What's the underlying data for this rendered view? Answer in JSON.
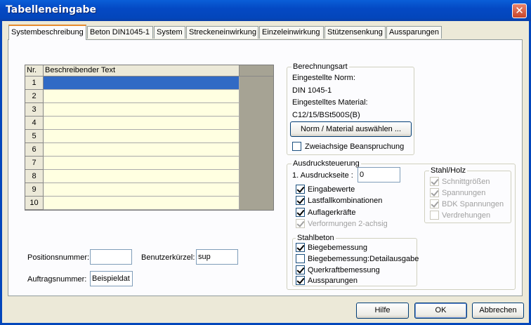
{
  "window": {
    "title": "Tabelleneingabe",
    "close_glyph": "✕"
  },
  "tabs": [
    {
      "label": "Systembeschreibung",
      "active": true
    },
    {
      "label": "Beton DIN1045-1"
    },
    {
      "label": "System"
    },
    {
      "label": "Streckeneinwirkung"
    },
    {
      "label": "Einzeleinwirkung"
    },
    {
      "label": "Stützensenkung"
    },
    {
      "label": "Aussparungen"
    }
  ],
  "table": {
    "col_nr": "Nr.",
    "col_text": "Beschreibender Text",
    "rows": [
      "1",
      "2",
      "3",
      "4",
      "5",
      "6",
      "7",
      "8",
      "9",
      "10"
    ],
    "selected_row": 1
  },
  "berechnungsart": {
    "title": "Berechnungsart",
    "norm_label": "Eingestellte Norm:",
    "norm_value": "DIN 1045-1",
    "material_label": "Eingestelltes Material:",
    "material_value": "C12/15/BSt500S(B)",
    "select_button": "Norm / Material auswählen ...",
    "zweiachsig": {
      "label": "Zweiachsige Beanspruchung",
      "checked": false
    }
  },
  "ausdruck": {
    "title": "Ausdrucksteuerung",
    "seite_label": "1. Ausdruckseite :",
    "seite_value": "0",
    "items": [
      {
        "label": "Eingabewerte",
        "checked": true
      },
      {
        "label": "Lastfallkombinationen",
        "checked": true
      },
      {
        "label": "Auflagerkräfte",
        "checked": true
      },
      {
        "label": "Verformungen 2-achsig",
        "checked": true,
        "disabled": true
      }
    ],
    "stahlholz": {
      "title": "Stahl/Holz",
      "items": [
        {
          "label": "Schnittgrößen",
          "checked": true
        },
        {
          "label": "Spannungen",
          "checked": true
        },
        {
          "label": "BDK Spannungen",
          "checked": true
        },
        {
          "label": "Verdrehungen",
          "checked": false
        }
      ]
    },
    "stahlbeton": {
      "title": "Stahlbeton",
      "items": [
        {
          "label": "Biegebemessung",
          "checked": true
        },
        {
          "label": "Biegebemessung:Detailausgabe",
          "checked": false
        },
        {
          "label": "Querkraftbemessung",
          "checked": true
        },
        {
          "label": "Aussparungen",
          "checked": true
        }
      ]
    }
  },
  "fields": {
    "position_label": "Positionsnummer:",
    "position_value": "",
    "benutzer_label": "Benutzerkürzel:",
    "benutzer_value": "sup",
    "auftrag_label": "Auftragsnummer:",
    "auftrag_value": "Beispieldat"
  },
  "buttons": {
    "help": "Hilfe",
    "ok": "OK",
    "cancel": "Abbrechen"
  }
}
